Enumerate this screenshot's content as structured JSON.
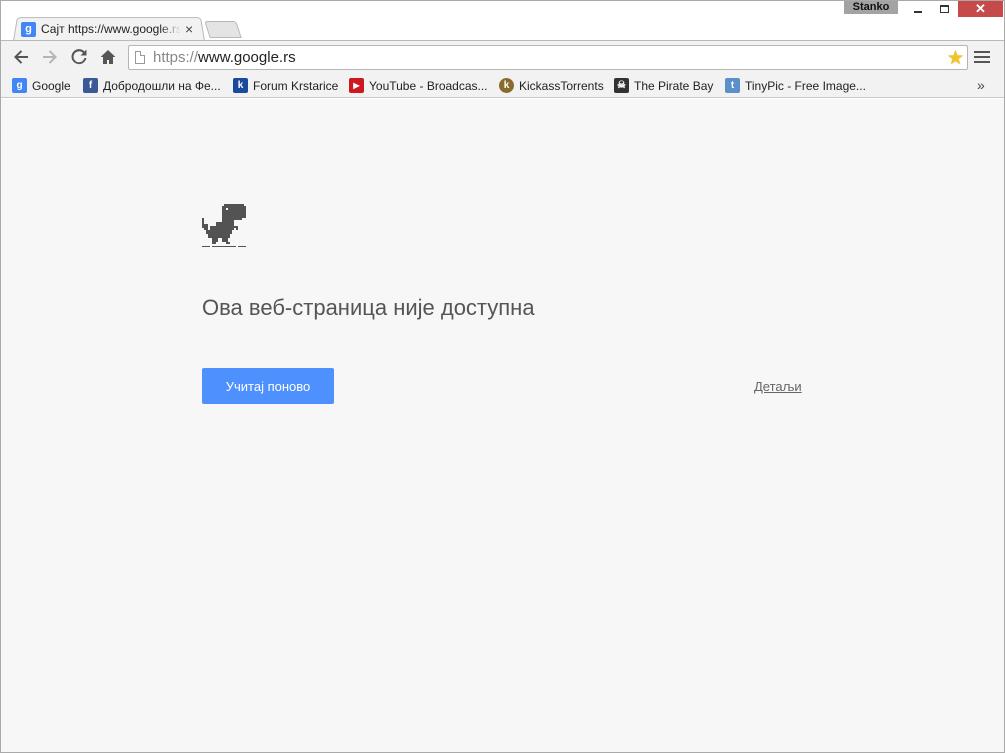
{
  "window": {
    "user_name": "Stanko",
    "minimize_label": "",
    "maximize_label": "",
    "close_label": "✕"
  },
  "tab": {
    "favicon_letter": "g",
    "title": "Сајт https://www.google.rs",
    "close_label": "×"
  },
  "toolbar": {
    "url_scheme": "https://",
    "url_host": "www.google.rs"
  },
  "bookmarks": {
    "items": [
      {
        "label": "Google",
        "icon": "google-icon",
        "icon_text": "g",
        "icon_color": "#4285f4"
      },
      {
        "label": "Добродошли на Фе...",
        "icon": "facebook-icon",
        "icon_text": "f",
        "icon_color": "#3b5998"
      },
      {
        "label": "Forum Krstarice",
        "icon": "krstarica-icon",
        "icon_text": "k",
        "icon_color": "#1a4a9c"
      },
      {
        "label": "YouTube - Broadcas...",
        "icon": "youtube-icon",
        "icon_text": "▶",
        "icon_color": "#cc181e"
      },
      {
        "label": "KickassTorrents",
        "icon": "kickass-icon",
        "icon_text": "k",
        "icon_color": "#8a6b2e"
      },
      {
        "label": "The Pirate Bay",
        "icon": "pirate-ship-icon",
        "icon_text": "☠",
        "icon_color": "#333333"
      },
      {
        "label": "TinyPic - Free Image...",
        "icon": "tinypic-icon",
        "icon_text": "t",
        "icon_color": "#5a8fc9"
      }
    ],
    "more_label": "»"
  },
  "error_page": {
    "title": "Ова веб-страница није доступна",
    "reload_label": "Учитај поново",
    "details_label": "Детаљи"
  },
  "colors": {
    "accent": "#4d90fe",
    "close_button": "#c74a4a",
    "content_bg": "#f7f7f7"
  }
}
